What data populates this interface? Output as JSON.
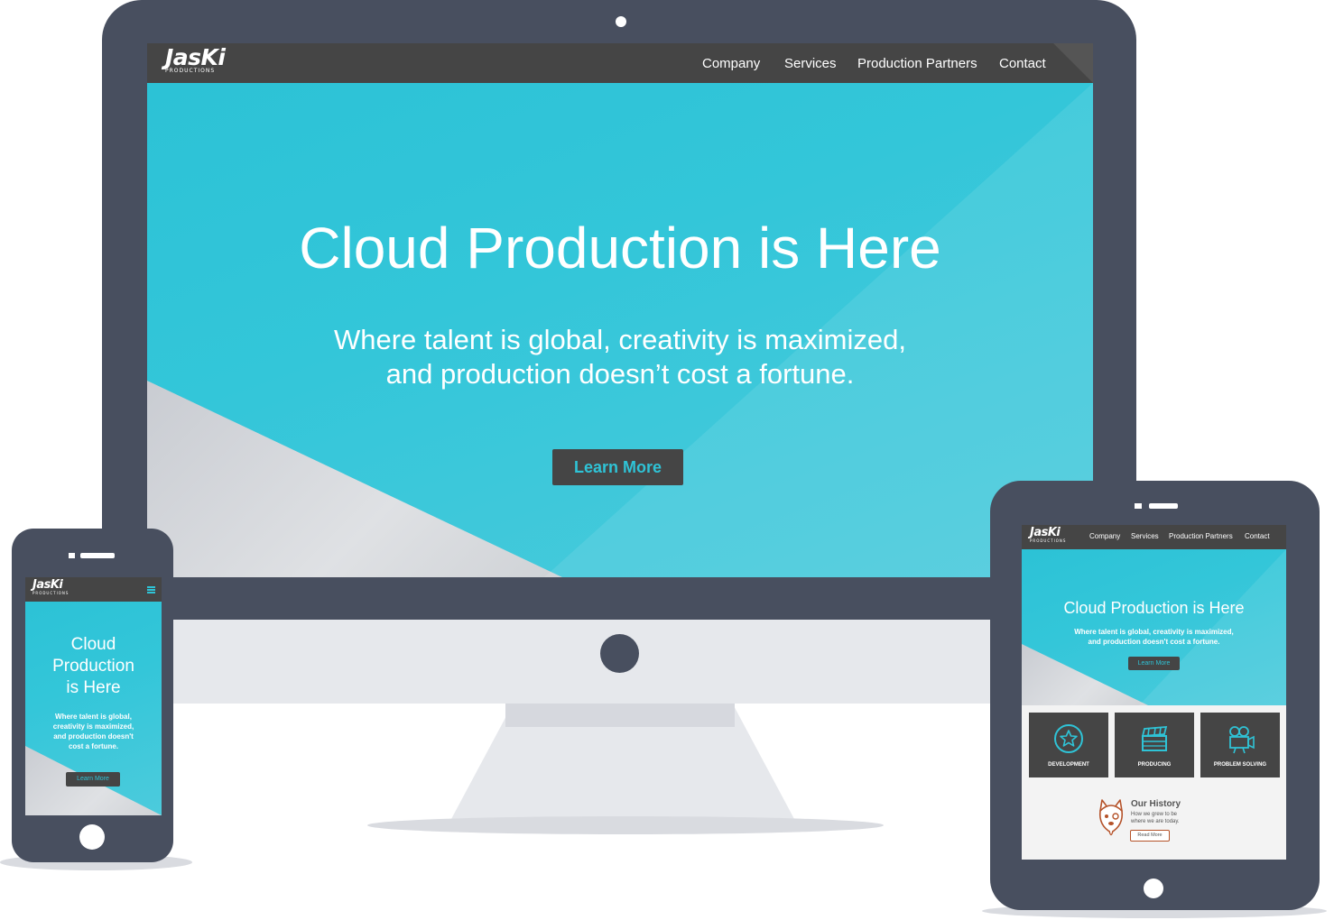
{
  "brand": {
    "logo_text": "JasKi",
    "logo_subtext": "PRODUCTIONS"
  },
  "nav": {
    "items": [
      "Company",
      "Services",
      "Production Partners",
      "Contact"
    ],
    "menu_icon": "hamburger-icon"
  },
  "hero": {
    "title": "Cloud Production is Here",
    "subtitle_line1": "Where talent is global, creativity is maximized,",
    "subtitle_line2": "and production doesn’t cost a fortune.",
    "button_label": "Learn More"
  },
  "phone_hero": {
    "title_line1": "Cloud",
    "title_line2": "Production",
    "title_line3": "is Here",
    "subtitle_line1": "Where talent is global,",
    "subtitle_line2": "creativity is maximized,",
    "subtitle_line3": "and production doesn't",
    "subtitle_line4": "cost a fortune."
  },
  "tablet_hero": {
    "subtitle_line1": "Where talent is global, creativity is maximized,",
    "subtitle_line2": "and production doesn't cost a fortune."
  },
  "services": [
    {
      "label": "DEVELOPMENT",
      "icon": "star-icon"
    },
    {
      "label": "PRODUCING",
      "icon": "clapperboard-icon"
    },
    {
      "label": "PROBLEM SOLVING",
      "icon": "video-camera-icon"
    }
  ],
  "history": {
    "title": "Our History",
    "text_line1": "How we grew to be",
    "text_line2": "where we are today.",
    "button_label": "Read More",
    "icon": "husky-mascot-icon"
  },
  "colors": {
    "device_frame": "#484f5f",
    "navbar": "#454545",
    "accent_cyan": "#2fc3d6",
    "history_accent": "#b5532a"
  }
}
